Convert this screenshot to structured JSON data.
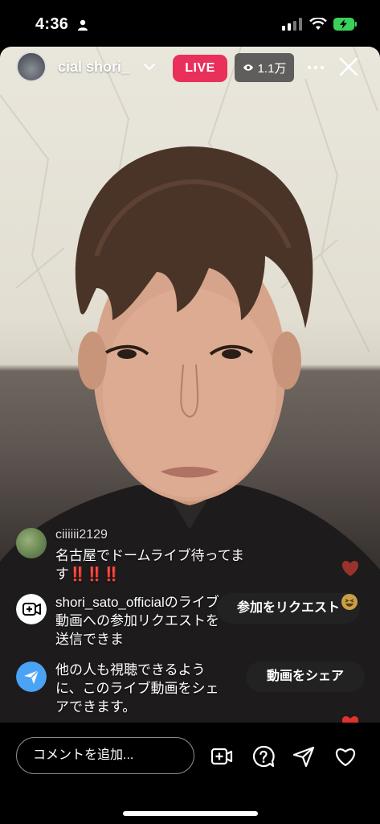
{
  "status_bar": {
    "time": "4:36"
  },
  "host": {
    "name": "cial  shori_"
  },
  "live": {
    "label": "LIVE",
    "viewers": "1.1万"
  },
  "comments": [
    {
      "user": "ciiiiii2129",
      "text": "名古屋でドームライブ待ってます",
      "emoji": "‼️‼️‼️"
    }
  ],
  "system_messages": [
    {
      "text": "shori_sato_officialのライブ動画への参加リクエストを送信できま",
      "action": "参加をリクエスト"
    },
    {
      "text": "他の人も視聴できるように、このライブ動画をシェアできます。",
      "action": "動画をシェア"
    }
  ],
  "comment_input": {
    "placeholder": "コメントを追加..."
  },
  "colors": {
    "live": "#e9305a",
    "share_icon_bg": "#4aa3f5",
    "heart": "#e0312d"
  }
}
